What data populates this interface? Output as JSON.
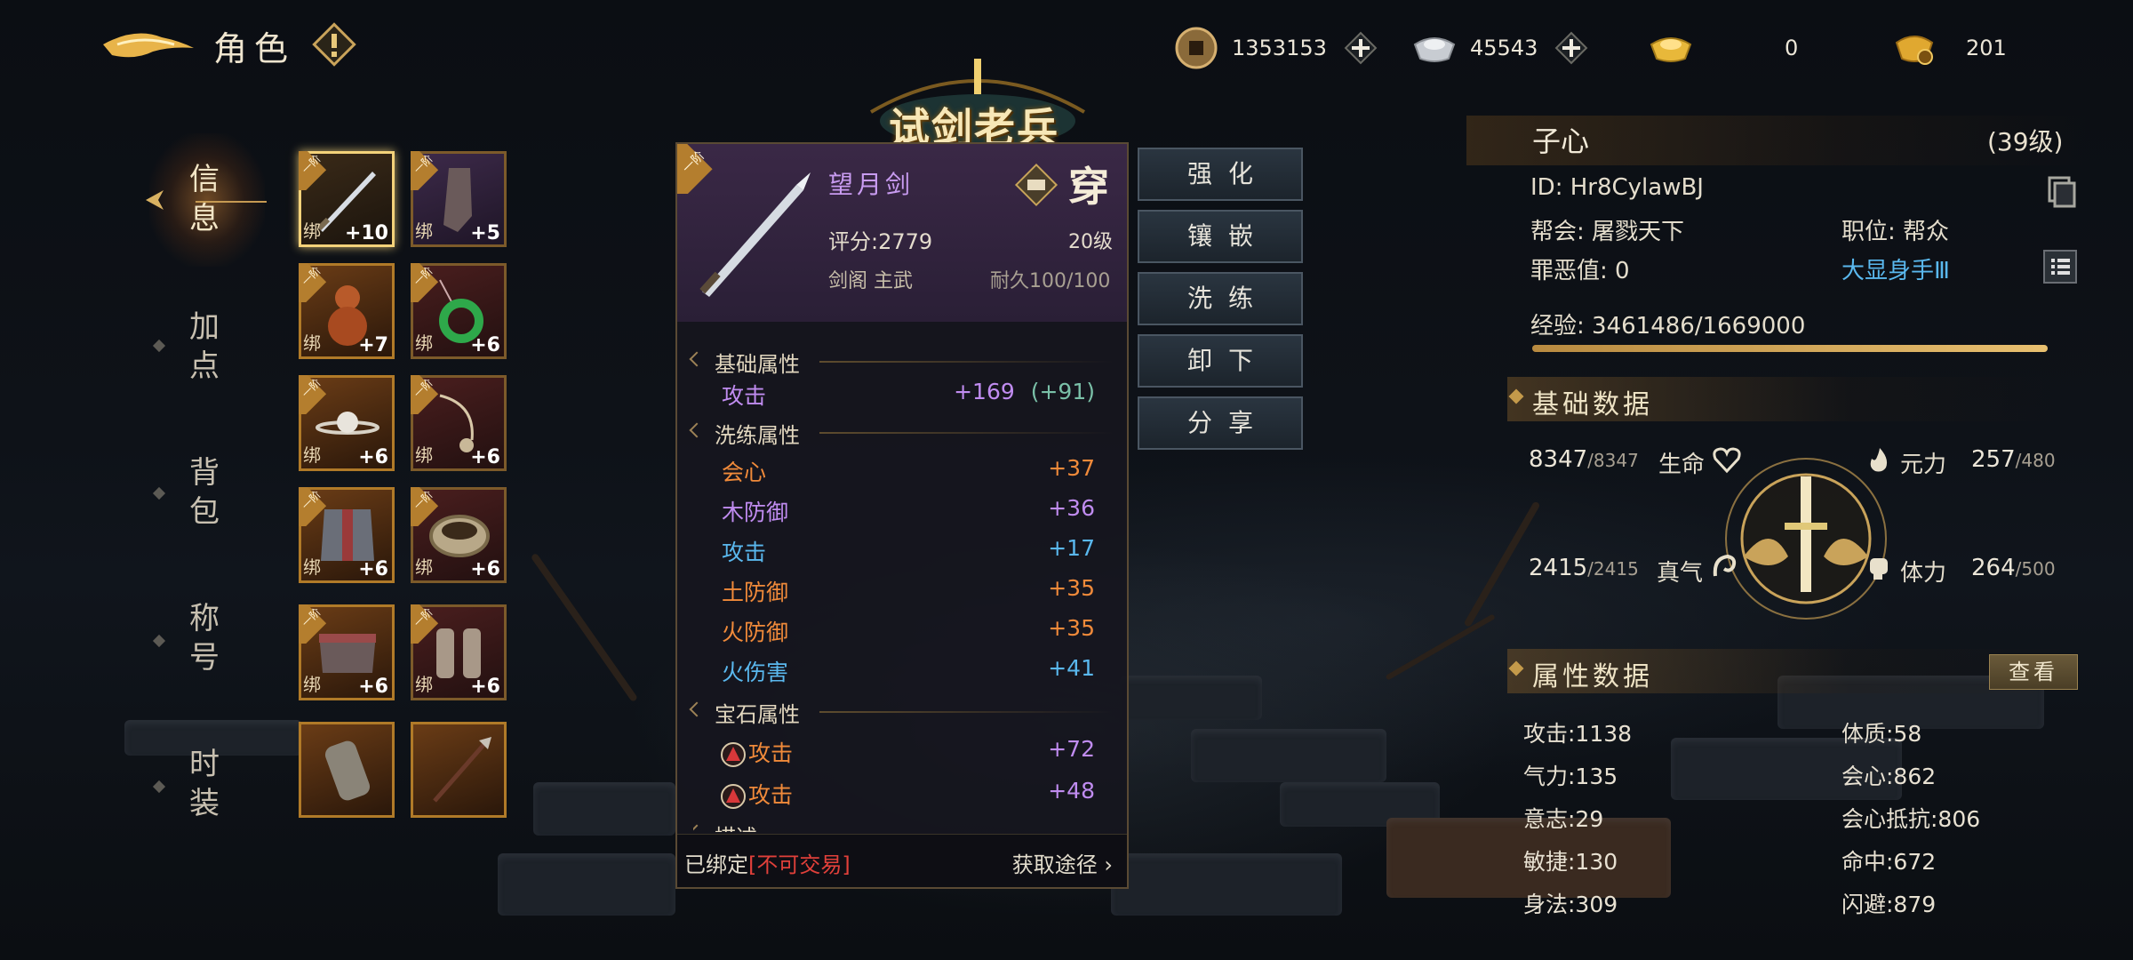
{
  "header": {
    "title": "角色",
    "currencies": [
      {
        "icon": "copper-coin-icon",
        "value": "1353153"
      },
      {
        "icon": "silver-ingot-icon",
        "value": "45543"
      },
      {
        "icon": "gold-ingot-icon",
        "value": "0"
      },
      {
        "icon": "gold-pouch-icon",
        "value": "201"
      }
    ]
  },
  "nav": {
    "items": [
      {
        "label": "信息",
        "active": true
      },
      {
        "label": "加点"
      },
      {
        "label": "背包"
      },
      {
        "label": "称号"
      },
      {
        "label": "时装"
      }
    ]
  },
  "equipment": {
    "tier_label": "一阶",
    "bind_label": "绑",
    "slots": [
      {
        "item": "sword",
        "level": "+10",
        "selected": true
      },
      {
        "item": "boots",
        "level": "+5"
      },
      {
        "item": "gourd",
        "level": "+7"
      },
      {
        "item": "jade-pendant",
        "level": "+6"
      },
      {
        "item": "ring",
        "level": "+6"
      },
      {
        "item": "necklace",
        "level": "+6"
      },
      {
        "item": "armor",
        "level": "+6"
      },
      {
        "item": "bracer",
        "level": "+6"
      },
      {
        "item": "belt",
        "level": "+6"
      },
      {
        "item": "gloves",
        "level": "+6"
      },
      {
        "item": "gauntlet"
      },
      {
        "item": "spear"
      }
    ]
  },
  "banner": {
    "text": "试剑老兵"
  },
  "item": {
    "tier": "一阶",
    "name": "望月剑",
    "equip_label": "穿",
    "score": "评分:2779",
    "req_level": "20级",
    "sect": "剑阁  主武",
    "durability": "耐久100/100",
    "sections": {
      "base": "基础属性",
      "refine": "洗练属性",
      "gem": "宝石属性",
      "desc": "描述"
    },
    "base_attrs": [
      {
        "name": "攻击",
        "value": "+169",
        "bonus": "(+91)"
      }
    ],
    "refine_attrs": [
      {
        "name": "会心",
        "value": "+37",
        "color": "#f08a3a"
      },
      {
        "name": "木防御",
        "value": "+36",
        "color": "#c08cf0"
      },
      {
        "name": "攻击",
        "value": "+17",
        "color": "#5ab8ee"
      },
      {
        "name": "土防御",
        "value": "+35",
        "color": "#f08a3a"
      },
      {
        "name": "火防御",
        "value": "+35",
        "color": "#f08a3a"
      },
      {
        "name": "火伤害",
        "value": "+41",
        "color": "#5ab8ee"
      }
    ],
    "gem_attrs": [
      {
        "name": "攻击",
        "value": "+72"
      },
      {
        "name": "攻击",
        "value": "+48"
      }
    ],
    "bound_text": "已绑定",
    "trade_text": "[不可交易]",
    "source_text": "获取途径"
  },
  "actions": [
    "强化",
    "镶嵌",
    "洗练",
    "卸下",
    "分享"
  ],
  "character": {
    "name": "子心",
    "level": "(39级)",
    "id": "ID: Hr8CylawBJ",
    "guild": "帮会: 屠戮天下",
    "position": "职位: 帮众",
    "sin": "罪恶值: 0",
    "title": "大显身手Ⅲ",
    "exp": "经验: 3461486/1669000",
    "exp_fill": 1.0
  },
  "basic_data": {
    "title": "基础数据",
    "hp": {
      "cur": "8347",
      "max": "/8347",
      "label": "生命"
    },
    "mana": {
      "cur": "257",
      "max": "/480",
      "label": "元力"
    },
    "qi": {
      "cur": "2415",
      "max": "/2415",
      "label": "真气"
    },
    "stamina": {
      "cur": "264",
      "max": "/500",
      "label": "体力"
    }
  },
  "attr_data": {
    "title": "属性数据",
    "view_label": "查看",
    "left": [
      "攻击:1138",
      "气力:135",
      "意志:29",
      "敏捷:130",
      "身法:309"
    ],
    "right": [
      "体质:58",
      "会心:862",
      "会心抵抗:806",
      "命中:672",
      "闪避:879"
    ]
  }
}
